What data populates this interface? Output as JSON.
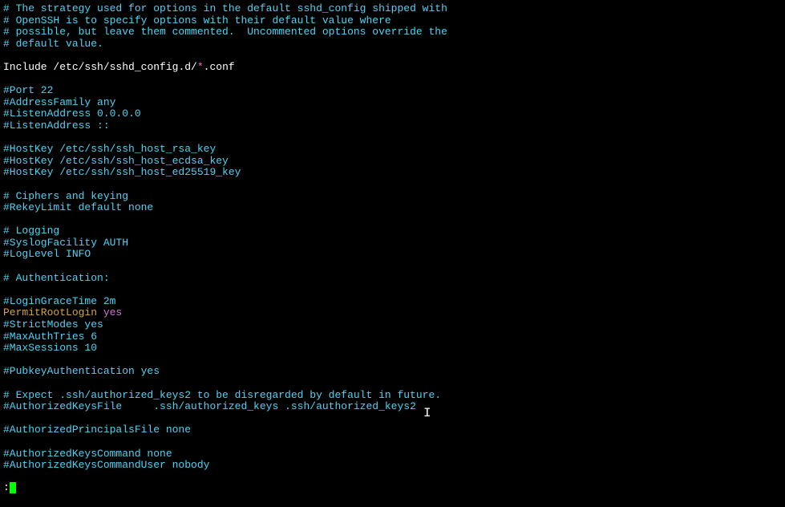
{
  "lines": {
    "c1": "# The strategy used for options in the default sshd_config shipped with",
    "c2": "# OpenSSH is to specify options with their default value where",
    "c3": "# possible, but leave them commented.  Uncommented options override the",
    "c4": "# default value.",
    "include_kw": "Include ",
    "include_path": "/etc/ssh/sshd_config.d/",
    "include_glob": "*",
    "include_ext": ".conf",
    "port": "#Port 22",
    "addrfam": "#AddressFamily any",
    "listen1": "#ListenAddress 0.0.0.0",
    "listen2": "#ListenAddress ::",
    "hk1": "#HostKey /etc/ssh/ssh_host_rsa_key",
    "hk2": "#HostKey /etc/ssh/ssh_host_ecdsa_key",
    "hk3": "#HostKey /etc/ssh/ssh_host_ed25519_key",
    "ciphers": "# Ciphers and keying",
    "rekey": "#RekeyLimit default none",
    "logging": "# Logging",
    "syslog": "#SyslogFacility AUTH",
    "loglevel": "#LogLevel INFO",
    "auth": "# Authentication:",
    "logingrace": "#LoginGraceTime 2m",
    "permitroot_kw": "PermitRootLogin",
    "permitroot_val": " yes",
    "strict": "#StrictModes yes",
    "maxauth": "#MaxAuthTries 6",
    "maxsess": "#MaxSessions 10",
    "pubkey": "#PubkeyAuthentication yes",
    "expect": "# Expect .ssh/authorized_keys2 to be disregarded by default in future.",
    "authkeys": "#AuthorizedKeysFile     .ssh/authorized_keys .ssh/authorized_keys2",
    "authprinc": "#AuthorizedPrincipalsFile none",
    "authcmd": "#AuthorizedKeysCommand none",
    "authcmduser": "#AuthorizedKeysCommandUser nobody"
  },
  "prompt": ":"
}
